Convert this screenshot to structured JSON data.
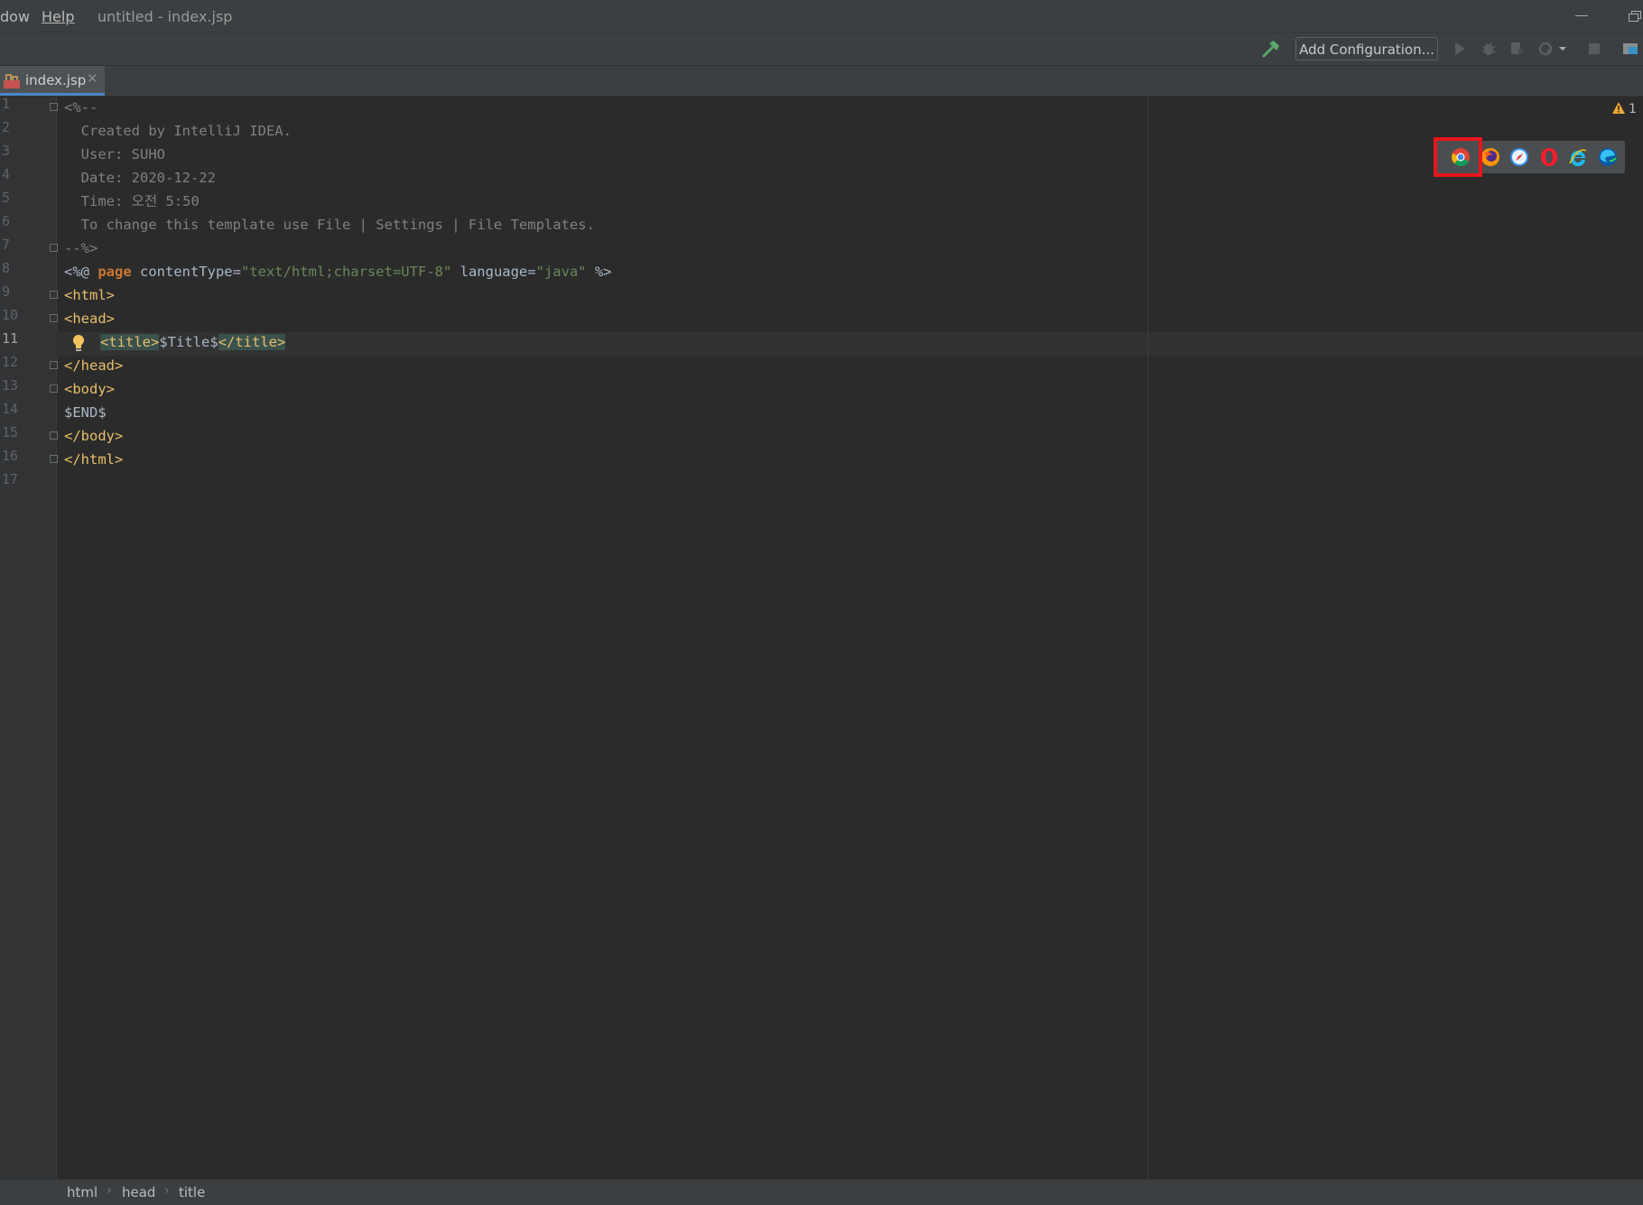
{
  "titlebar": {
    "menu_window": "dow",
    "menu_help": "Help",
    "title": "untitled - index.jsp"
  },
  "toolbar": {
    "add_configuration": "Add Configuration..."
  },
  "tab": {
    "label": "index.jsp",
    "close": "✕"
  },
  "editor": {
    "line_numbers": [
      "1",
      "2",
      "3",
      "4",
      "5",
      "6",
      "7",
      "8",
      "9",
      "10",
      "11",
      "12",
      "13",
      "14",
      "15",
      "16",
      "17"
    ],
    "active_line": "11",
    "lines": {
      "l1": "<%--",
      "l2": "  Created by IntelliJ IDEA.",
      "l3": "  User: SUHO",
      "l4": "  Date: 2020-12-22",
      "l5": "  Time: 오전 5:50",
      "l6": "  To change this template use File | Settings | File Templates.",
      "l7": "--%>",
      "l8": {
        "open": "<%@ ",
        "page": "page",
        "attr1": " contentType=",
        "val1": "\"text/html;charset=UTF-8\"",
        "attr2": " language=",
        "val2": "\"java\"",
        "close": " %>"
      },
      "l9": "<html>",
      "l10": "<head>",
      "l11": {
        "open": "<title>",
        "text": "$Title$",
        "close": "</title>"
      },
      "l12": "</head>",
      "l13": "<body>",
      "l14": "$END$",
      "l15": "</body>",
      "l16": "</html>"
    },
    "warning_count": "1"
  },
  "browsers": [
    "chrome-icon",
    "firefox-icon",
    "safari-icon",
    "opera-icon",
    "internet-explorer-icon",
    "edge-icon"
  ],
  "colors": {
    "highlight": "#e8161b",
    "tag": "#e8bf6a",
    "string": "#6a8759",
    "keyword": "#cc7832",
    "comment": "#808080"
  },
  "breadcrumb": [
    "html",
    "head",
    "title"
  ]
}
